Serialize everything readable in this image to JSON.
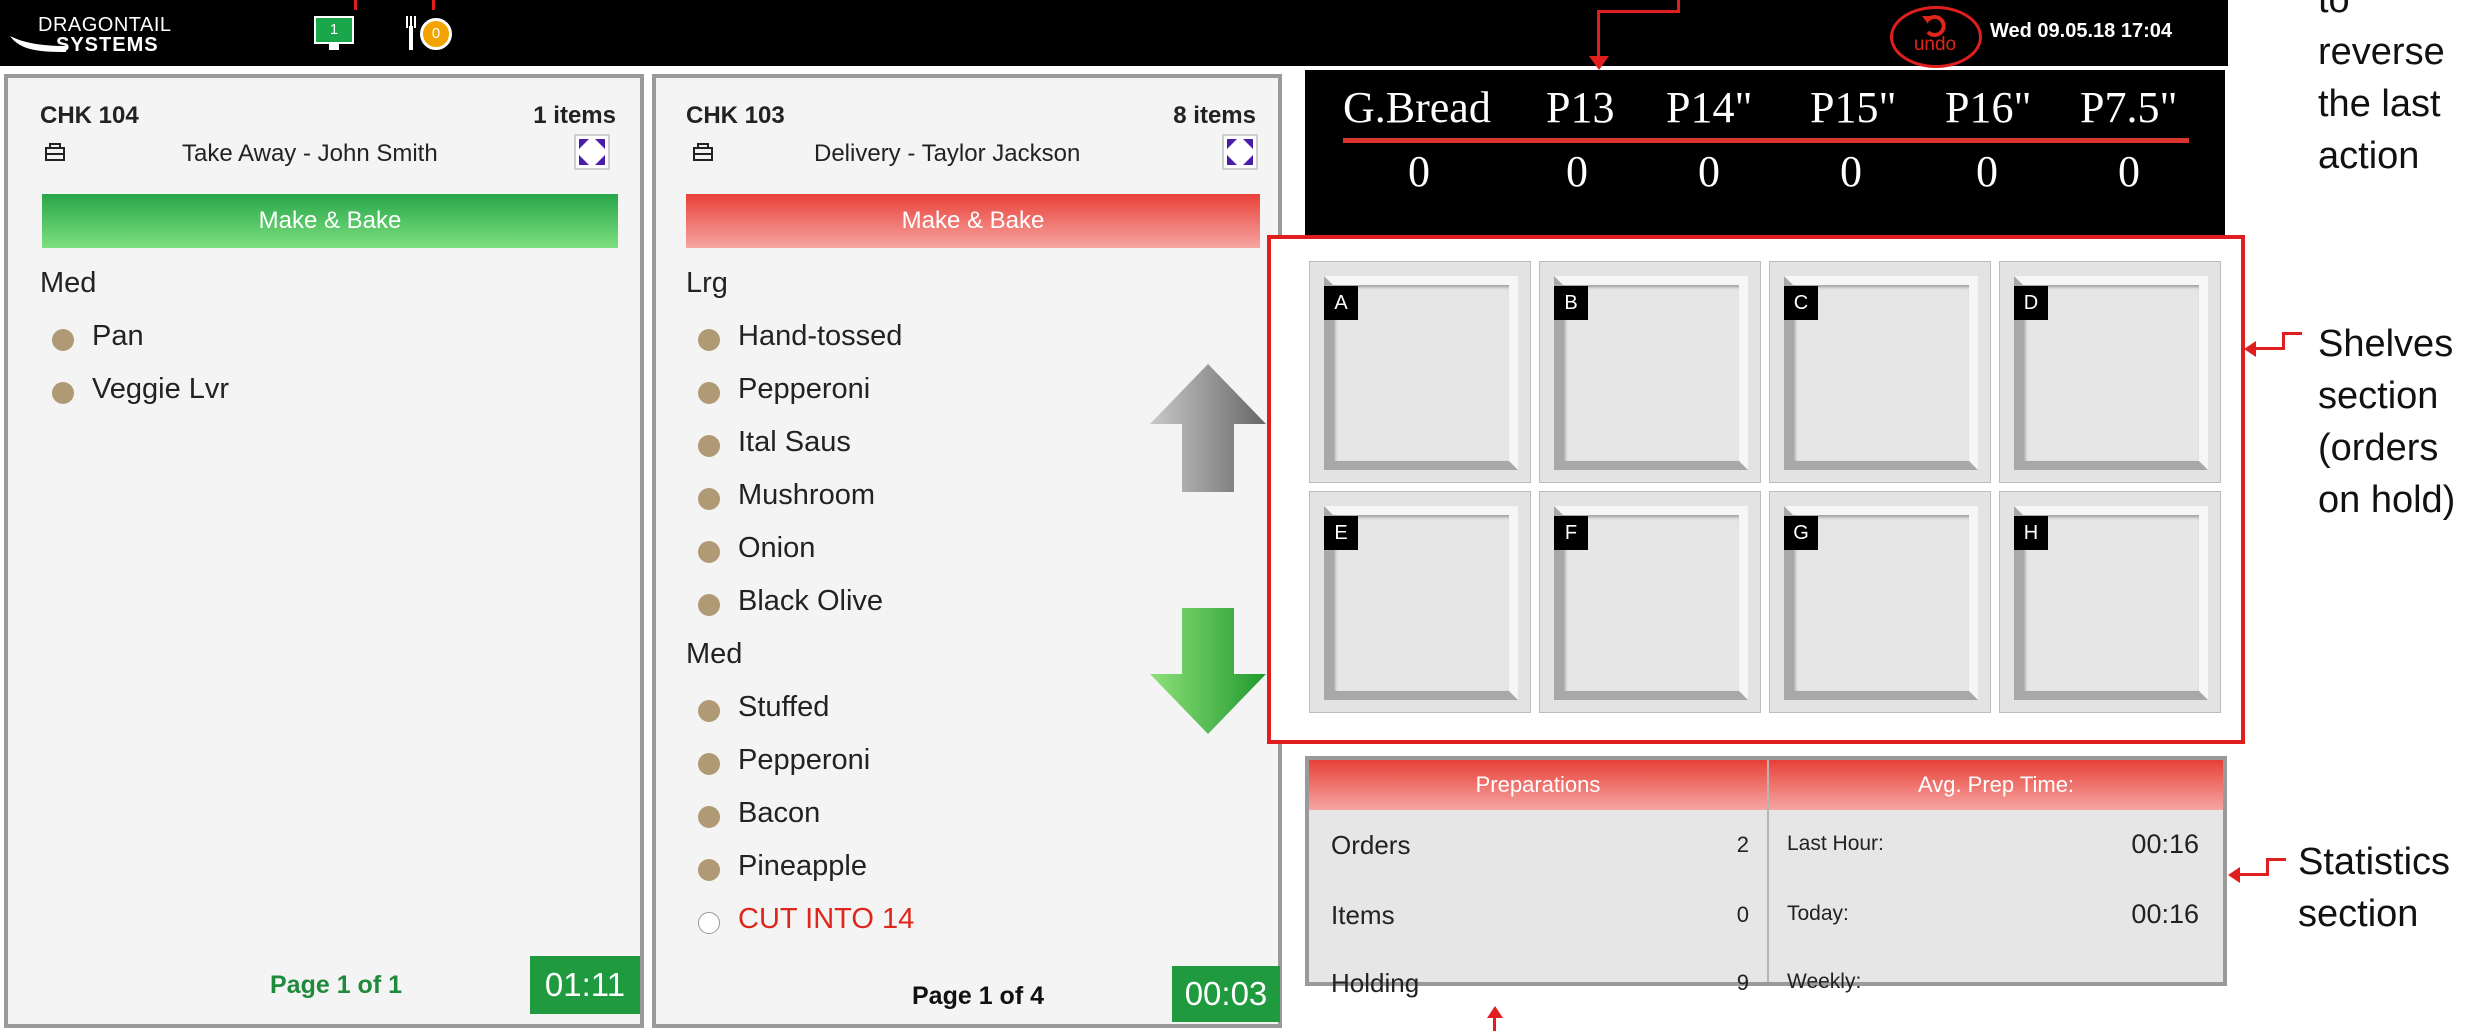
{
  "topbar": {
    "logo_line1": "DRAGONTAIL",
    "logo_line2": "SYSTEMS",
    "monitor_badge": "1",
    "plates_badge": "0",
    "undo_label": "undo",
    "datetime": "Wed 09.05.18 17:04"
  },
  "orders": [
    {
      "check": "CHK 104",
      "count": "1 items",
      "type": "Take Away - John Smith",
      "station": "Make & Bake",
      "status_color": "#27a64a",
      "groups": [
        {
          "size": "Med",
          "items": [
            "Pan",
            "Veggie Lvr"
          ]
        }
      ],
      "page": "Page 1 of 1",
      "page_color": "#1f8a3a",
      "timer": "01:11"
    },
    {
      "check": "CHK 103",
      "count": "8 items",
      "type": "Delivery - Taylor Jackson",
      "station": "Make & Bake",
      "status_color": "#e84038",
      "groups": [
        {
          "size": "Lrg",
          "items": [
            "Hand-tossed",
            "Pepperoni",
            "Ital Saus",
            "Mushroom",
            "Onion",
            "Black Olive"
          ]
        },
        {
          "size": "Med",
          "items": [
            "Stuffed",
            "Pepperoni",
            "Bacon",
            "Pineapple"
          ]
        }
      ],
      "modifier": "CUT INTO 14",
      "page": "Page 1 of 4",
      "page_color": "#111111",
      "timer": "00:03"
    }
  ],
  "counts": {
    "headers": [
      "G.Bread",
      "P13",
      "P14\"",
      "P15\"",
      "P16\"",
      "P7.5\""
    ],
    "values": [
      "0",
      "0",
      "0",
      "0",
      "0",
      "0"
    ]
  },
  "shelves": [
    "A",
    "B",
    "C",
    "D",
    "E",
    "F",
    "G",
    "H"
  ],
  "stats": {
    "preparations_title": "Preparations",
    "avg_title": "Avg. Prep Time:",
    "rows": [
      {
        "label": "Orders",
        "value": "2"
      },
      {
        "label": "Items",
        "value": "0"
      },
      {
        "label": "Holding",
        "value": "9"
      }
    ],
    "avg_rows": [
      {
        "label": "Last Hour:",
        "value": "00:16"
      },
      {
        "label": "Today:",
        "value": "00:16"
      },
      {
        "label": "Weekly:",
        "value": ""
      }
    ]
  },
  "annotations": {
    "undo_lines": [
      "to",
      "reverse",
      "the last",
      "action"
    ],
    "shelves_lines": [
      "Shelves",
      "section",
      "(orders",
      "on hold)"
    ],
    "stats_lines": [
      "Statistics",
      "section"
    ]
  },
  "colors": {
    "accent_red": "#e01e1e",
    "status_green": "#1f9a3e",
    "topbar": "#000000"
  }
}
